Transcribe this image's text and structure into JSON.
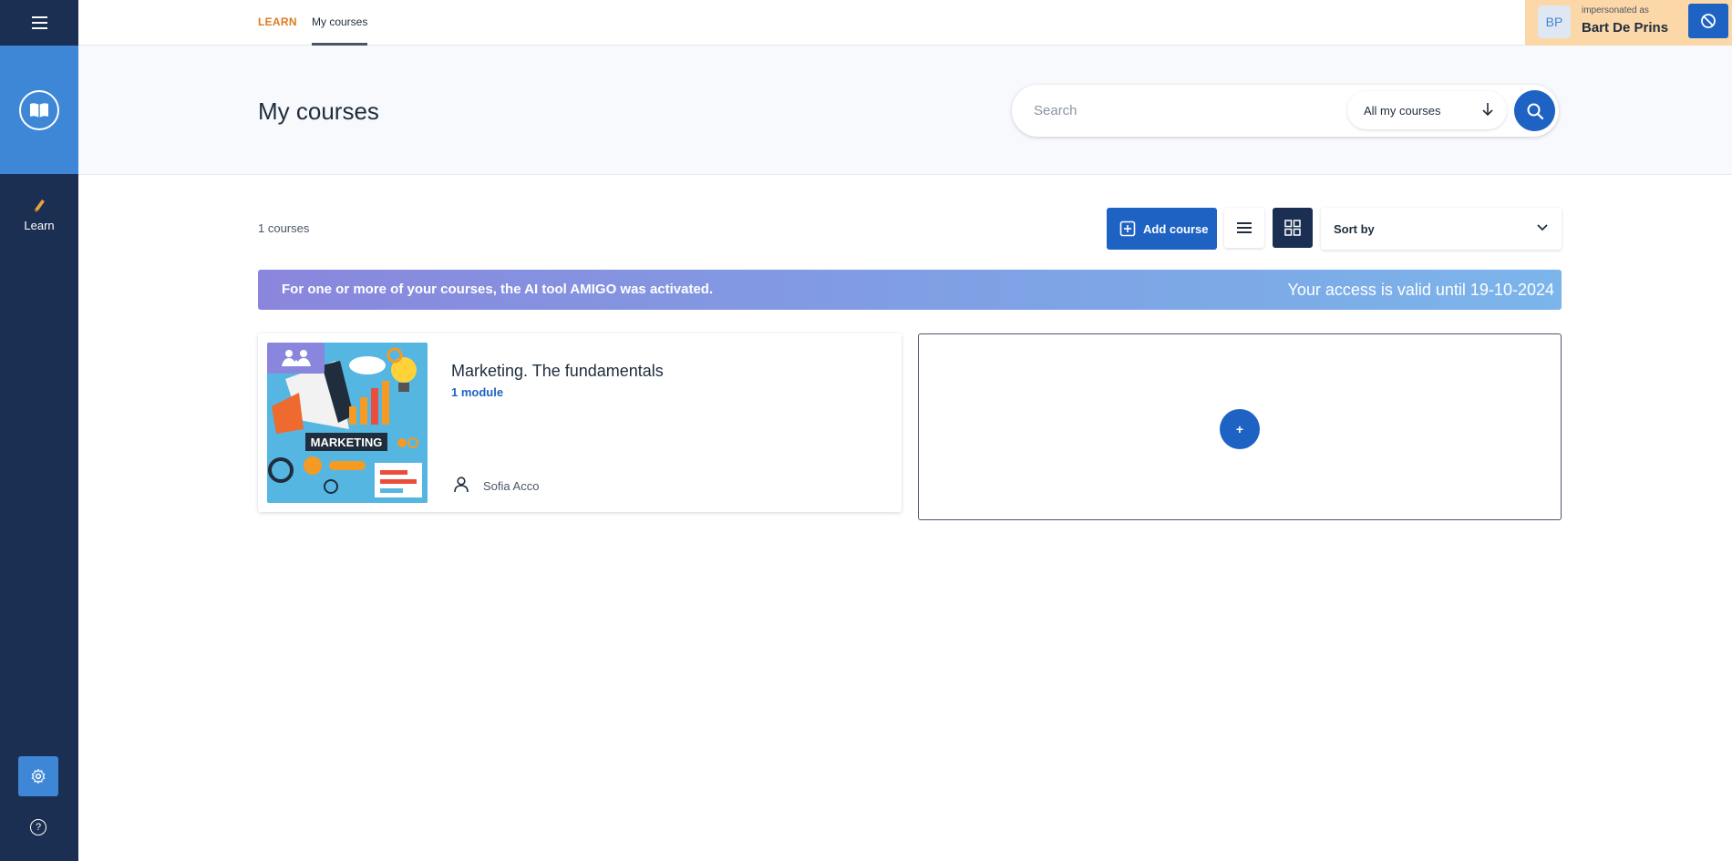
{
  "nav": {
    "learn_tab": "LEARN",
    "my_courses_tab": "My courses",
    "sidebar_learn": "Learn",
    "help_symbol": "?"
  },
  "impersonation": {
    "initials": "BP",
    "label": "impersonated as",
    "name": "Bart De Prins"
  },
  "page": {
    "title": "My courses",
    "search_placeholder": "Search",
    "filter": "All my courses"
  },
  "toolbar": {
    "count": "1 courses",
    "add_course": "Add course",
    "sort_by": "Sort by"
  },
  "banner": {
    "message": "For one or more of your courses, the AI tool AMIGO was activated.",
    "access": "Your access is valid until 19-10-2024"
  },
  "courses": [
    {
      "title": "Marketing. The fundamentals",
      "modules": "1 module",
      "author": "Sofia Acco",
      "thumbnail_text": "MARKETING"
    }
  ],
  "add_card": {
    "symbol": "+"
  },
  "colors": {
    "sidebar": "#1b2f52",
    "accent_blue": "#1e63c4",
    "logo_blue": "#3e86d6",
    "learn_orange": "#e07a1f",
    "impersonation_bg": "#fcd7a8"
  },
  "icons": [
    "menu-icon",
    "book-icon",
    "learn-icon",
    "gear-icon",
    "help-icon",
    "block-icon",
    "arrow-down-icon",
    "search-icon",
    "plus-square-icon",
    "list-view-icon",
    "grid-view-icon",
    "chevron-down-icon",
    "group-icon",
    "user-icon"
  ]
}
